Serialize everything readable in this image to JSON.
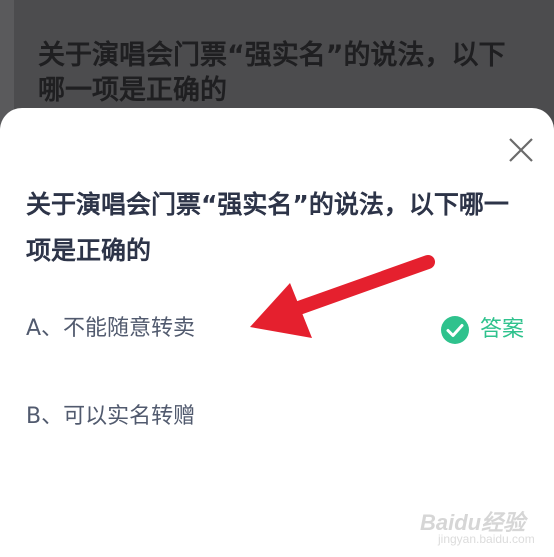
{
  "background": {
    "question_text": "关于演唱会门票“强实名”的说法，以下哪一项是正确的"
  },
  "dialog": {
    "question_text": "关于演唱会门票“强实名”的说法，以下哪一项是正确的",
    "options": [
      {
        "label": "A、不能随意转卖"
      },
      {
        "label": "B、可以实名转赠"
      }
    ],
    "answer_label": "答案"
  },
  "colors": {
    "accent_green": "#2fc28d",
    "annotation_arrow": "#e5202e"
  },
  "icons": {
    "close": "close-icon",
    "answer": "check-circle-icon"
  },
  "watermark": {
    "brand": "Baidu经验",
    "url": "jingyan.baidu.com"
  }
}
